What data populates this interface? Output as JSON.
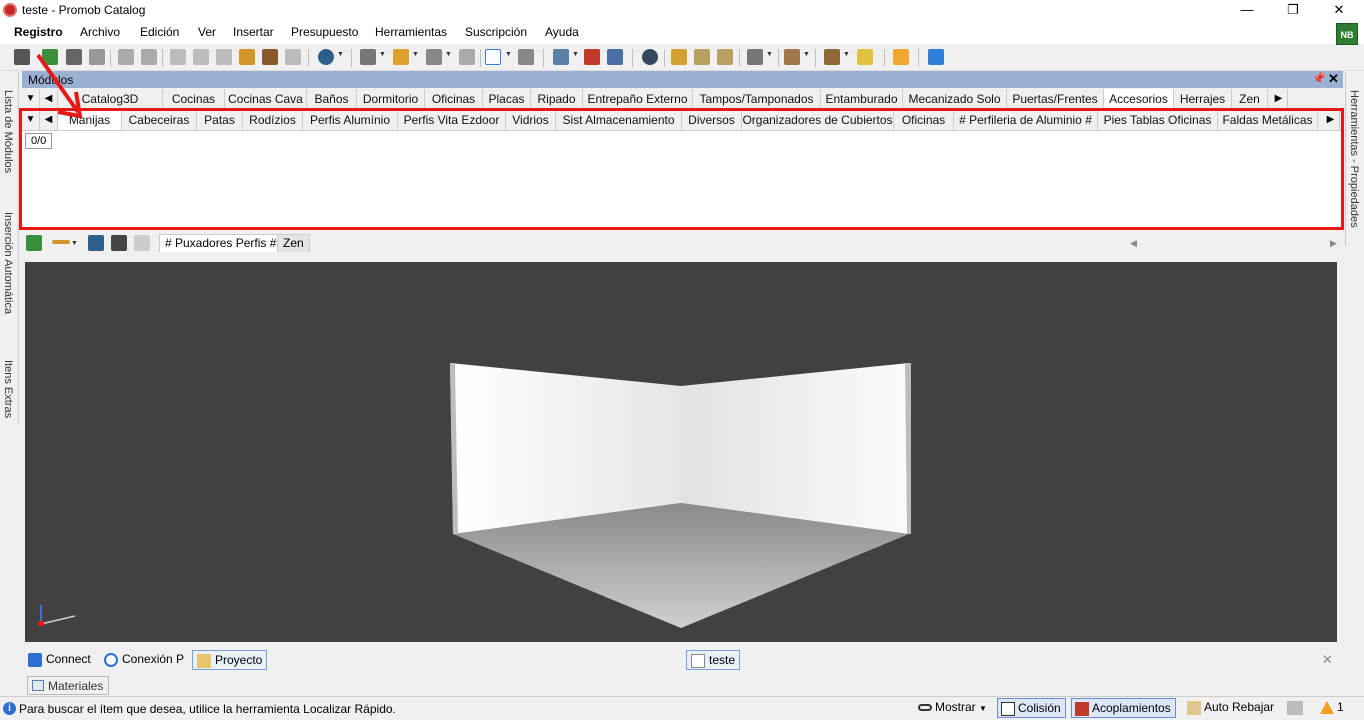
{
  "window": {
    "title": "teste - Promob Catalog",
    "minimize": "—",
    "maximize": "❐",
    "close": "✕"
  },
  "user_badge": "NB",
  "menu": [
    "Registro",
    "Archivo",
    "Edición",
    "Ver",
    "Insertar",
    "Presupuesto",
    "Herramientas",
    "Suscripción",
    "Ayuda"
  ],
  "left_rail": [
    "Lista de Módulos",
    "Inserción Automática",
    "Itens Extras"
  ],
  "right_rail": [
    "Herramientas - Propiedades"
  ],
  "panel": {
    "title": "Módulos",
    "pin": "📌",
    "close": "✕"
  },
  "tabs_row1": [
    "Catalog3D",
    "Cocinas",
    "Cocinas Cava",
    "Baños",
    "Dormitorio",
    "Oficinas",
    "Placas",
    "Ripado",
    "Entrepaño Externo",
    "Tampos/Tamponados",
    "Entamburado",
    "Mecanizado Solo",
    "Puertas/Frentes",
    "Accesorios",
    "Herrajes",
    "Zen"
  ],
  "tabs_row1_active": "Accesorios",
  "tabs_row2": [
    "Manijas",
    "Cabeceiras",
    "Patas",
    "Rodízios",
    "Perfis Alumínio",
    "Perfis Vita Ezdoor",
    "Vidrios",
    "Sist Almacenamiento",
    "Diversos",
    "Organizadores de Cubiertos",
    "Oficinas",
    "# Perfileria de Aluminio #",
    "Pies Tablas Oficinas",
    "Faldas Metálicas"
  ],
  "tabs_row2_active": "Manijas",
  "counter": "0/0",
  "subbar_tabs": [
    "# Puxadores Perfis #",
    "Zen"
  ],
  "bottom_tabs": [
    {
      "label": "Connect",
      "icon": "rss-icon"
    },
    {
      "label": "Conexión P",
      "icon": "promob-connect-icon"
    },
    {
      "label": "Proyecto",
      "icon": "folder-icon"
    }
  ],
  "document_tab": "teste",
  "materials_tab": "Materiales",
  "status": {
    "text": "Para buscar el ítem que desea, utilice la herramienta Localizar Rápido.",
    "mostrar": "Mostrar",
    "colision": "Colisión",
    "acoplamientos": "Acoplamientos",
    "auto_rebajar": "Auto Rebajar",
    "warnings": "1"
  },
  "colors": {
    "panel_header": "#9ab1d3",
    "highlight": "#e81818",
    "viewport": "#414141"
  }
}
